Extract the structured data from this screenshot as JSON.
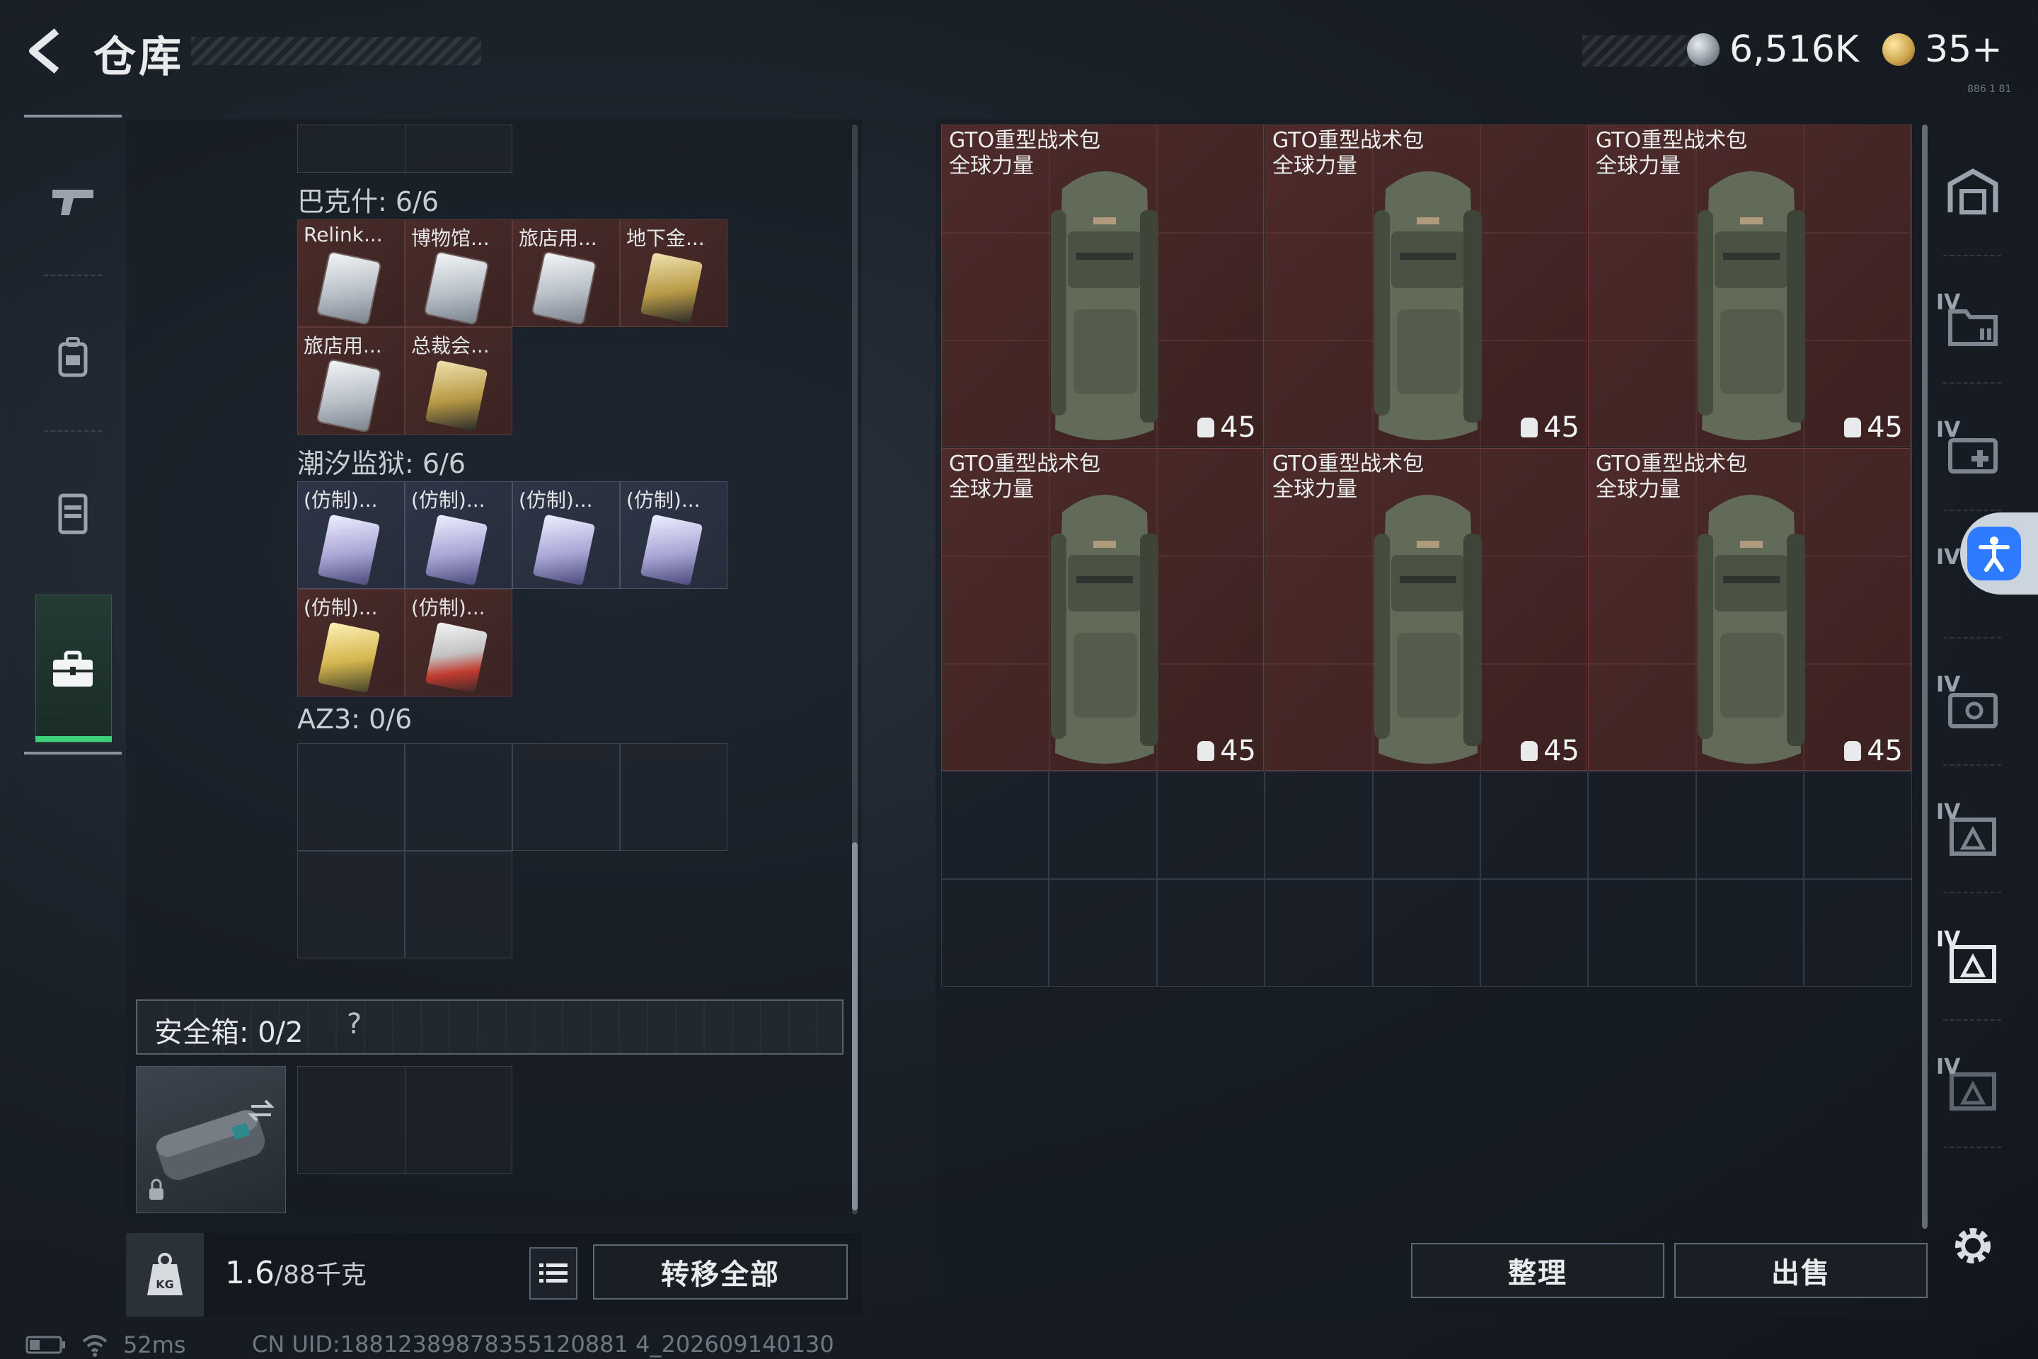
{
  "header": {
    "title": "仓库",
    "currency_silver": "6,516K",
    "currency_gold": "35+",
    "tiny_label": "886 1 81"
  },
  "left_nav": {
    "items": [
      {
        "name": "weapons",
        "icon": "gun-icon"
      },
      {
        "name": "gear",
        "icon": "backpack-icon"
      },
      {
        "name": "vest",
        "icon": "vest-icon"
      },
      {
        "name": "safebox",
        "icon": "briefcase-icon",
        "active": true
      }
    ]
  },
  "backpack": {
    "sections": [
      {
        "title": "巴克什: 6/6",
        "items": [
          {
            "label": "Relink...",
            "style": "silver"
          },
          {
            "label": "博物馆...",
            "style": "silver"
          },
          {
            "label": "旅店用...",
            "style": "silver"
          },
          {
            "label": "地下金...",
            "style": "goldc"
          },
          {
            "label": "旅店用...",
            "style": "silver"
          },
          {
            "label": "总裁会...",
            "style": "goldc"
          }
        ]
      },
      {
        "title": "潮汐监狱: 6/6",
        "items": [
          {
            "label": "(仿制)...",
            "style": "purple"
          },
          {
            "label": "(仿制)...",
            "style": "purple"
          },
          {
            "label": "(仿制)...",
            "style": "purple"
          },
          {
            "label": "(仿制)...",
            "style": "purple"
          },
          {
            "label": "(仿制)...",
            "style": "yellow"
          },
          {
            "label": "(仿制)...",
            "style": "redc"
          }
        ]
      },
      {
        "title": "AZ3: 0/6",
        "items": []
      }
    ],
    "safebox_label": "安全箱: 0/2",
    "safebox_help": "?",
    "weight_value": "1.6",
    "weight_unit": "/88千克",
    "transfer_all": "转移全部"
  },
  "storage": {
    "bags": [
      {
        "name": "GTO重型战术包",
        "brand": "全球力量",
        "capacity": "45"
      },
      {
        "name": "GTO重型战术包",
        "brand": "全球力量",
        "capacity": "45"
      },
      {
        "name": "GTO重型战术包",
        "brand": "全球力量",
        "capacity": "45"
      },
      {
        "name": "GTO重型战术包",
        "brand": "全球力量",
        "capacity": "45"
      },
      {
        "name": "GTO重型战术包",
        "brand": "全球力量",
        "capacity": "45"
      },
      {
        "name": "GTO重型战术包",
        "brand": "全球力量",
        "capacity": "45"
      }
    ],
    "sort_label": "整理",
    "sell_label": "出售"
  },
  "right_column": {
    "labels": [
      "",
      "IV",
      "IV",
      "IV",
      "IV",
      "IV",
      "IV",
      "IV"
    ]
  },
  "status": {
    "ping": "52ms",
    "uid": "CN UID:18812389878355120881 4_202609140130"
  },
  "colors": {
    "item_red": "#4a2c2a",
    "active_green": "#3dd17a",
    "accessibility_blue": "#2f7bff"
  }
}
